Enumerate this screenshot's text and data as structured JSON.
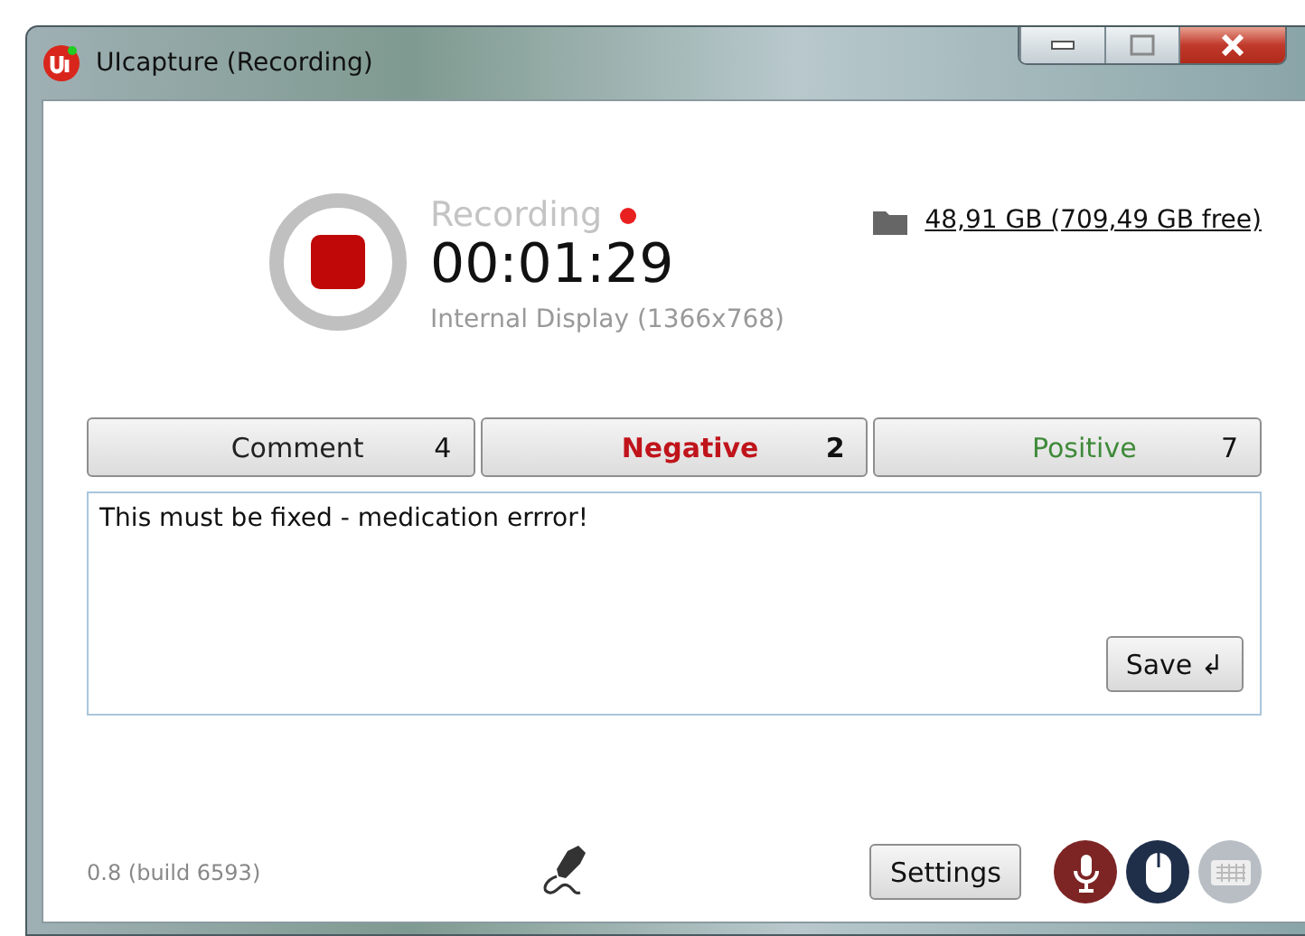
{
  "window": {
    "title": "UIcapture (Recording)"
  },
  "recording": {
    "status": "Recording",
    "live": true,
    "elapsed": "00:01:29",
    "source": "Internal Display (1366x768)"
  },
  "storage": {
    "text": "48,91 GB (709,49 GB free)"
  },
  "categories": [
    {
      "label": "Comment",
      "count": "4",
      "selected": false,
      "color": "#222222"
    },
    {
      "label": "Negative",
      "count": "2",
      "selected": true,
      "color": "#c0141b"
    },
    {
      "label": "Positive",
      "count": "7",
      "selected": false,
      "color": "#3f8a3a"
    }
  ],
  "note": {
    "value": "This must be fixed - medication errror!",
    "save_label": "Save ↲"
  },
  "footer": {
    "version": "0.8 (build 6593)",
    "settings_label": "Settings",
    "inputs": [
      {
        "kind": "microphone",
        "on": true
      },
      {
        "kind": "mouse",
        "on": true
      },
      {
        "kind": "keyboard",
        "on": false
      }
    ]
  }
}
